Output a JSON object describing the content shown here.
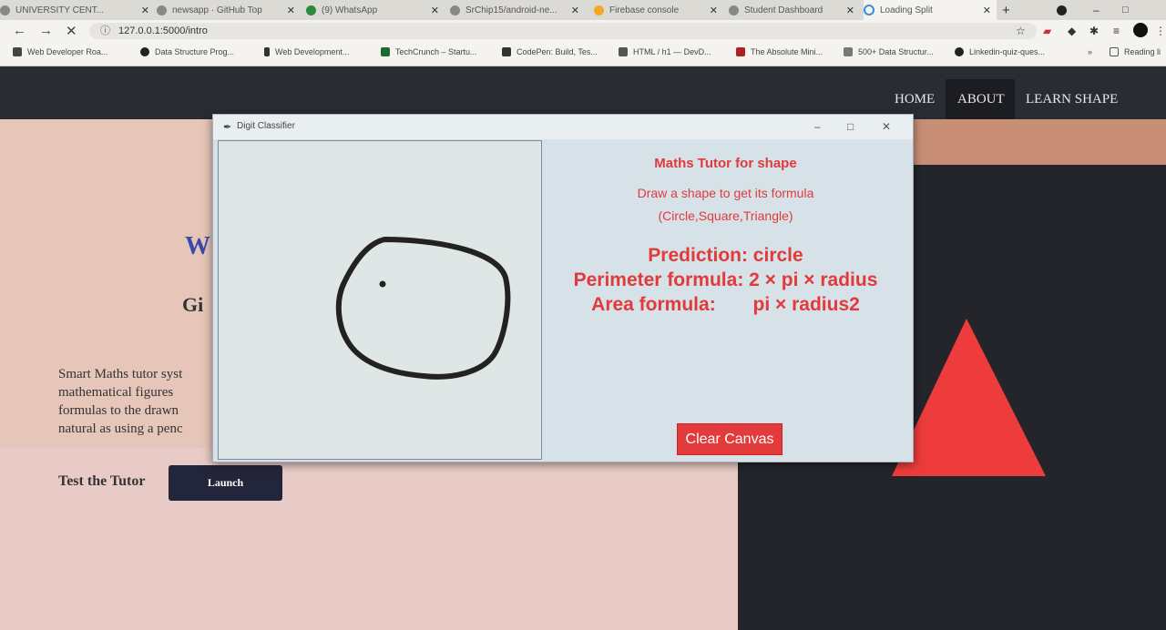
{
  "browser": {
    "tabs": [
      {
        "label": "UNIVERSITY CENT..."
      },
      {
        "label": "newsapp · GitHub Top"
      },
      {
        "label": "(9) WhatsApp"
      },
      {
        "label": "SrChip15/android-ne..."
      },
      {
        "label": "Firebase console"
      },
      {
        "label": "Student Dashboard"
      },
      {
        "label": "Loading Split"
      }
    ],
    "new_tab": "+",
    "url": "127.0.0.1:5000/intro",
    "bookmarks": [
      "Web Developer Roa...",
      "Data Structure Prog...",
      "Web Development...",
      "TechCrunch – Startu...",
      "CodePen: Build, Tes...",
      "HTML / h1 — DevD...",
      "The Absolute Mini...",
      "500+ Data Structur...",
      "Linkedin-quiz-ques..."
    ],
    "reading_list": "Reading li"
  },
  "site": {
    "nav": {
      "home": "HOME",
      "about": "ABOUT",
      "learn": "LEARN SHAPE"
    },
    "hero_partial": "W",
    "subtitle_partial": "Gi",
    "description_lines": [
      "Smart Maths tutor syst",
      "mathematical figures",
      "formulas to the drawn",
      "natural as using a penc"
    ],
    "test_label": "Test the Tutor",
    "launch_label": "Launch"
  },
  "app": {
    "title": "Digit Classifier",
    "heading": "Maths Tutor for shape",
    "instruction": "Draw a shape to get its formula",
    "shapes": "(Circle,Square,Triangle)",
    "prediction": "Prediction: circle",
    "perimeter": "Perimeter formula: 2 × pi × radius",
    "area": "Area formula:       pi × radius2",
    "clear_button": "Clear Canvas"
  },
  "colors": {
    "accent_red": "#e23a3a",
    "nav_bg": "#2a2c34",
    "triangle": "#ee3b3b"
  }
}
